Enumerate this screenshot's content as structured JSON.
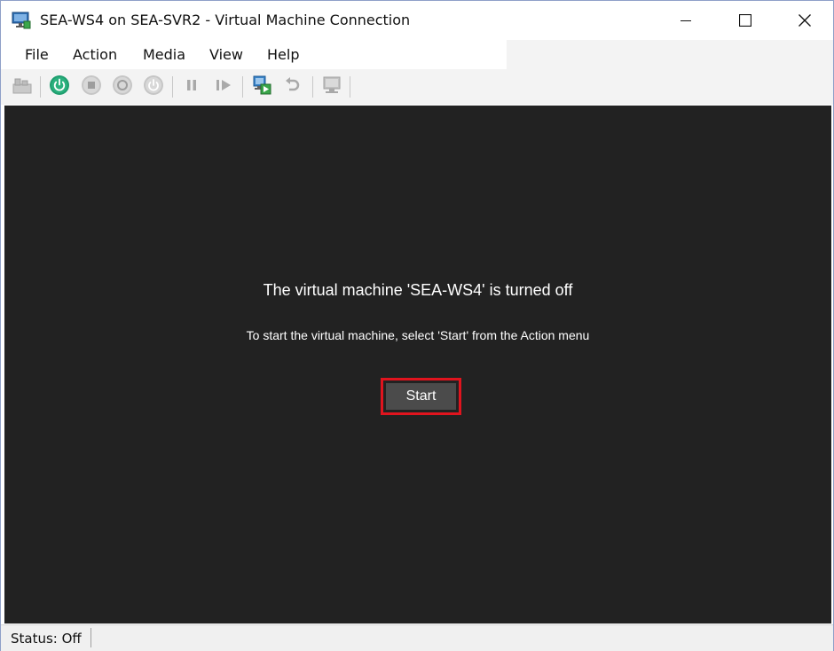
{
  "window": {
    "title": "SEA-WS4 on SEA-SVR2 - Virtual Machine Connection",
    "app_icon": "vm-monitor-icon"
  },
  "caption_buttons": [
    "minimize-icon",
    "maximize-icon",
    "close-icon"
  ],
  "menu": {
    "items": [
      "File",
      "Action",
      "Media",
      "View",
      "Help"
    ]
  },
  "toolbar": {
    "buttons": [
      "ctrl-alt-del-icon",
      "start-icon",
      "turn-off-icon",
      "shut-down-icon",
      "save-icon",
      "pause-icon",
      "reset-icon",
      "checkpoint-icon",
      "revert-icon",
      "enhanced-session-icon"
    ]
  },
  "screen": {
    "message": "The virtual machine 'SEA-WS4' is turned off",
    "instruction": "To start the virtual machine, select 'Start' from the Action menu",
    "start_button": "Start",
    "highlight_color": "#e0141e",
    "background_color": "#222222"
  },
  "status": {
    "text": "Status: Off"
  }
}
